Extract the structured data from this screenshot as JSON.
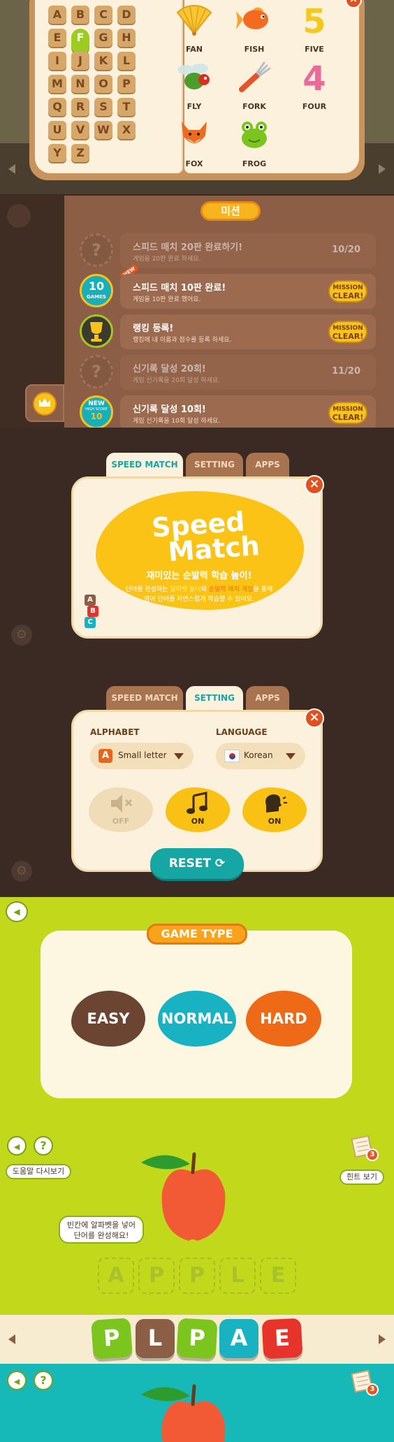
{
  "alphabet_book": {
    "letters": [
      "A",
      "B",
      "C",
      "D",
      "E",
      "F",
      "G",
      "H",
      "I",
      "J",
      "K",
      "L",
      "M",
      "N",
      "O",
      "P",
      "Q",
      "R",
      "S",
      "T",
      "U",
      "V",
      "W",
      "X",
      "Y",
      "Z"
    ],
    "selected_letter": "F",
    "words": [
      {
        "label": "FAN",
        "icon": "fan-icon"
      },
      {
        "label": "FISH",
        "icon": "fish-icon"
      },
      {
        "label": "FIVE",
        "icon": "number-five-icon"
      },
      {
        "label": "FLY",
        "icon": "fly-icon"
      },
      {
        "label": "FORK",
        "icon": "fork-icon"
      },
      {
        "label": "FOUR",
        "icon": "number-four-icon"
      },
      {
        "label": "FOX",
        "icon": "fox-icon"
      },
      {
        "label": "FROG",
        "icon": "frog-icon"
      }
    ],
    "five_glyph": "5",
    "four_glyph": "4",
    "close_glyph": "×",
    "prev_icon": "arrow-left-icon",
    "next_icon": "arrow-right-icon"
  },
  "missions": {
    "title": "미션",
    "items": [
      {
        "title": "스피드 매치 20판 완료하기!",
        "desc": "게임을 20판 완료 하세요.",
        "progress": "10/20",
        "status": "locked",
        "icon": "question-icon"
      },
      {
        "title": "스피드 매치 10판 완료!",
        "desc": "게임을 10판 완료 했어요.",
        "status": "clear",
        "icon": "10-games-badge",
        "badge_num": "10",
        "badge_text": "GAMES",
        "new_tag": "NEW"
      },
      {
        "title": "랭킹 등록!",
        "desc": "랭킹에 내 이름과 점수를 등록 하세요.",
        "status": "clear",
        "icon": "trophy-icon"
      },
      {
        "title": "신기록 달성 20회!",
        "desc": "게임 신기록을 20회 달성 하세요.",
        "progress": "11/20",
        "status": "locked",
        "icon": "question-icon"
      },
      {
        "title": "신기록 달성 10회!",
        "desc": "게임 신기록을 10회 달성 하세요.",
        "status": "clear",
        "icon": "new-high-score-badge",
        "badge_num": "10",
        "badge_text": "NEW",
        "badge_sub": "HIGH SCORE"
      }
    ],
    "clear_line1": "MISSION",
    "clear_line2": "CLEAR!"
  },
  "tabs": [
    "SPEED MATCH",
    "SETTING",
    "APPS"
  ],
  "about": {
    "logo_line1": "Speed",
    "logo_line2": "Match",
    "tagline": "재미있는 순발력 학습 놀이!",
    "desc_before": "단어를 완성하는 ",
    "desc_hl1": "알파벳 놀이",
    "desc_mid": "와 ",
    "desc_hl2": "순발력 매치 게임",
    "desc_after": "을 통해",
    "desc_line2": "영어 단어를 자연스럽게 학습할 수 있어요.",
    "blocks": [
      "A",
      "B",
      "C"
    ]
  },
  "settings": {
    "alphabet_label": "ALPHABET",
    "alphabet_value": "Small letter",
    "alphabet_icon": "A",
    "language_label": "LANGUAGE",
    "language_value": "Korean",
    "toggles": [
      {
        "name": "sound-effects",
        "state": "OFF",
        "icon": "speaker-muted-icon"
      },
      {
        "name": "music",
        "state": "ON",
        "icon": "music-note-icon"
      },
      {
        "name": "voice",
        "state": "ON",
        "icon": "voice-icon"
      }
    ],
    "reset_label": "RESET"
  },
  "game_type": {
    "title": "GAME TYPE",
    "options": [
      "EASY",
      "NORMAL",
      "HARD"
    ],
    "colors": [
      "#6b4432",
      "#19b2c2",
      "#ef6a16"
    ]
  },
  "play": {
    "help_label": "도움말 다시보기",
    "hint_label": "힌트 보기",
    "hint_count": "3",
    "bubble_line1": "빈칸에 알파벳을 넣어",
    "bubble_line2": "단어를 완성해요!",
    "target_word": [
      "A",
      "P",
      "P",
      "L",
      "E"
    ],
    "picture": "apple-icon",
    "tiles": [
      {
        "letter": "P",
        "color": "#7cc41e"
      },
      {
        "letter": "L",
        "color": "#8b5e45"
      },
      {
        "letter": "P",
        "color": "#7cc41e"
      },
      {
        "letter": "A",
        "color": "#19b2c2"
      },
      {
        "letter": "E",
        "color": "#e8332b"
      }
    ]
  },
  "play2": {
    "hint_count": "3"
  },
  "glyphs": {
    "help": "?",
    "close": "×",
    "back": "◀"
  }
}
